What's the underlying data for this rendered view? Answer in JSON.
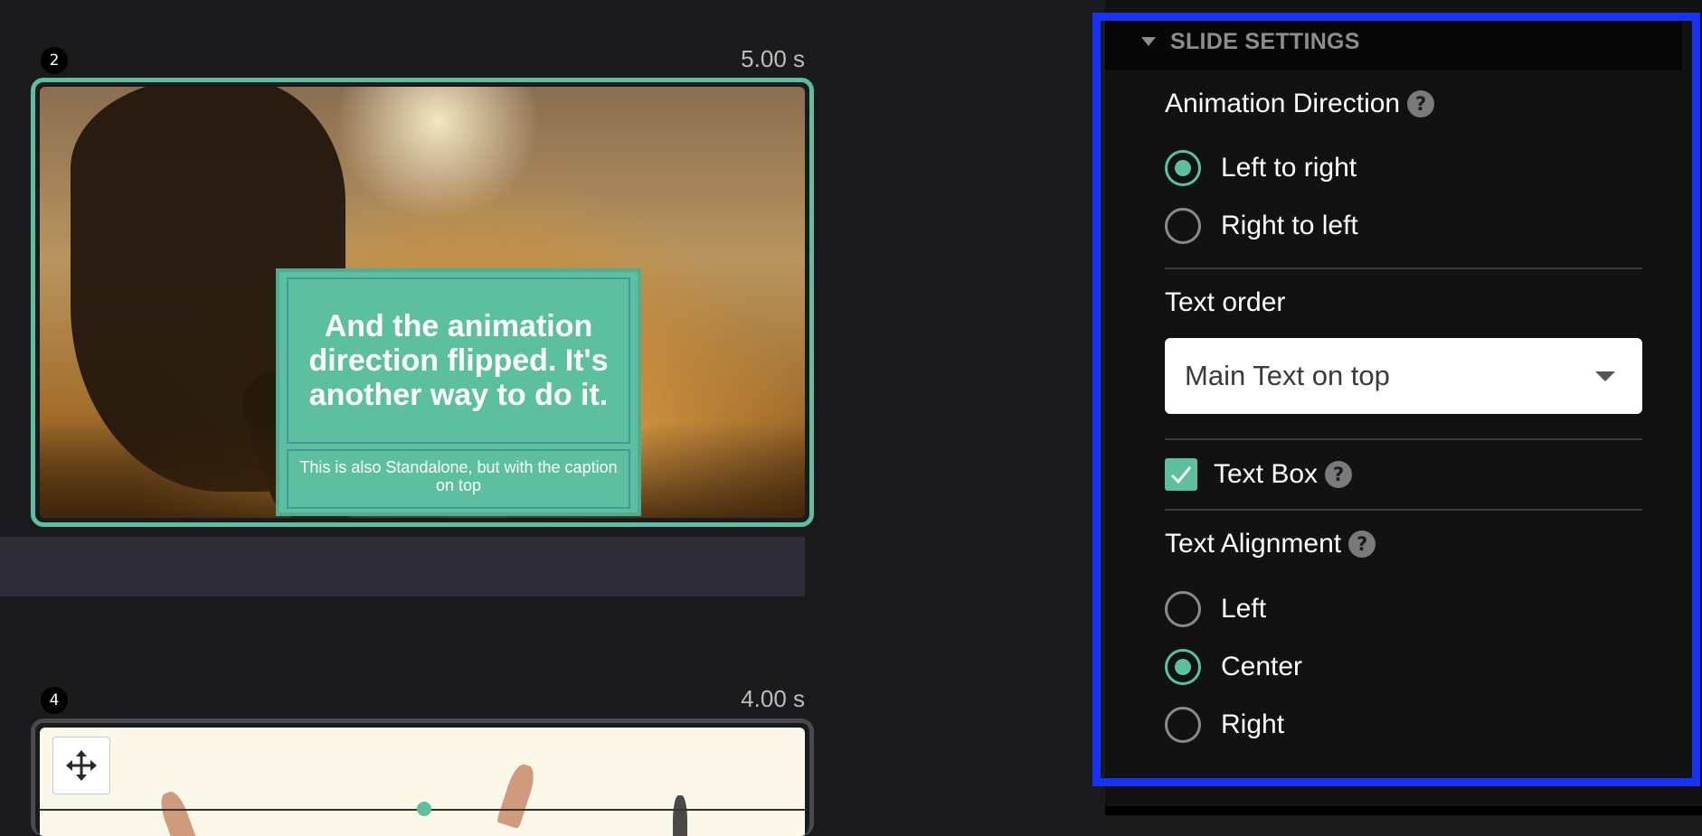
{
  "timeline": {
    "slides": [
      {
        "number": "2",
        "duration": "5.00 s",
        "main_text": "And the animation direction flipped. It's another way to do it.",
        "caption_text": "This is also Standalone, but with the caption on top"
      },
      {
        "number": "4",
        "duration": "4.00 s"
      }
    ]
  },
  "panel": {
    "section_title": "SLIDE SETTINGS",
    "animation_direction": {
      "label": "Animation Direction",
      "options": [
        "Left to right",
        "Right to left"
      ],
      "selected": "Left to right"
    },
    "text_order": {
      "label": "Text order",
      "value": "Main Text on top"
    },
    "text_box": {
      "label": "Text Box",
      "checked": true
    },
    "text_alignment": {
      "label": "Text Alignment",
      "options": [
        "Left",
        "Center",
        "Right"
      ],
      "selected": "Center"
    },
    "help_glyph": "?"
  },
  "colors": {
    "accent": "#5bbfa0",
    "highlight": "#1733f5",
    "panel_background": "#121213",
    "page_background": "#1b1b1d"
  }
}
